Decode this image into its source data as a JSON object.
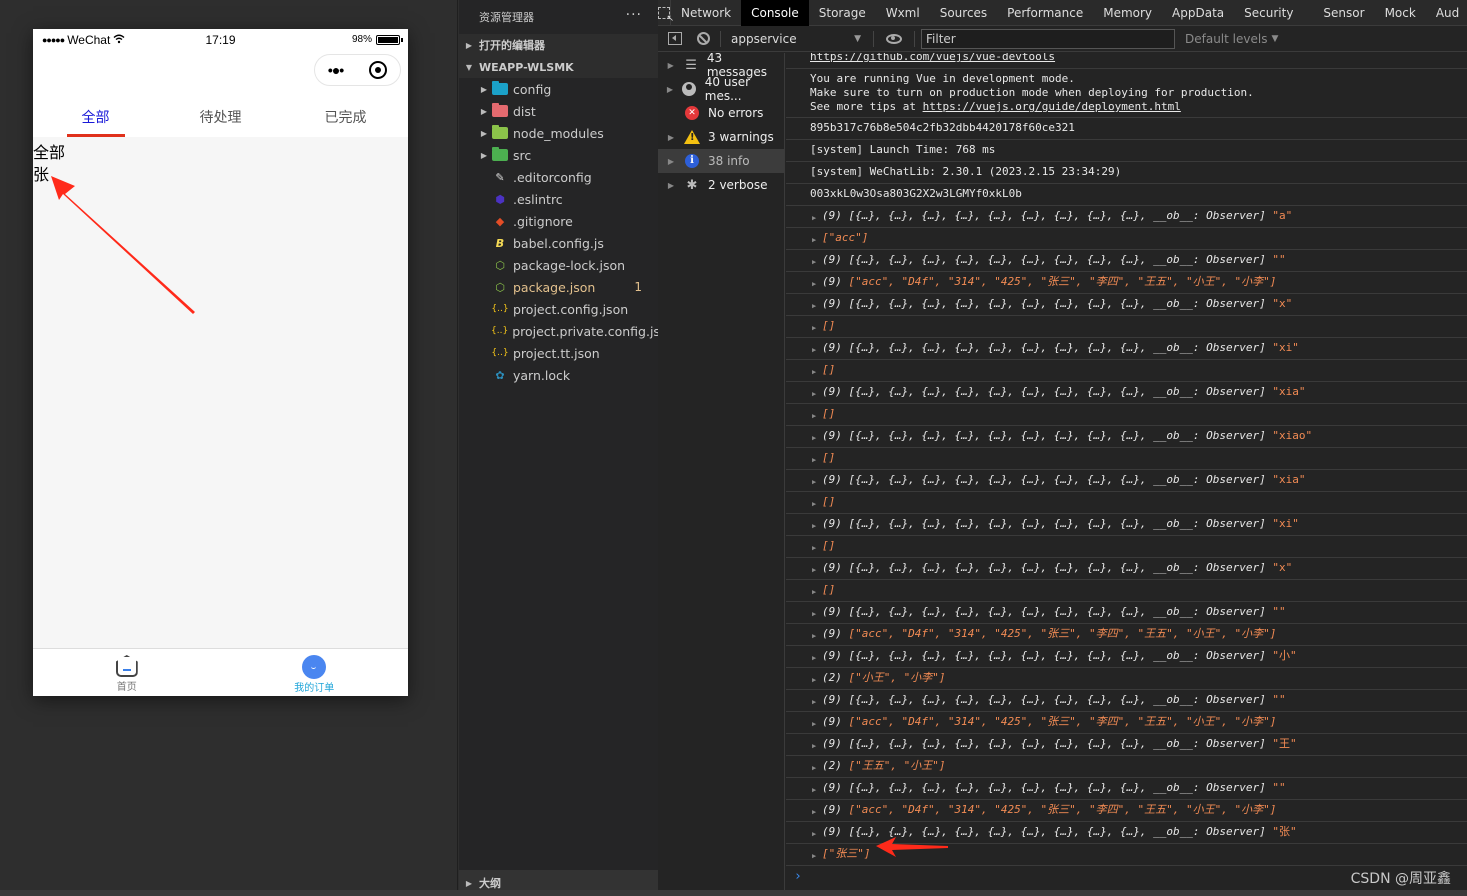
{
  "simulator": {
    "status_bar": {
      "signal": "●●●●●",
      "carrier": "WeChat",
      "wifi_icon": "wifi-icon",
      "time": "17:19",
      "battery_text": "98%",
      "battery_level": 0.98
    },
    "capsule": {
      "more_icon": "•●•",
      "close_icon": "target-icon"
    },
    "tabs": [
      {
        "label": "全部",
        "active": true
      },
      {
        "label": "待处理",
        "active": false
      },
      {
        "label": "已完成",
        "active": false
      }
    ],
    "content_lines": [
      "全部",
      "张"
    ],
    "tabbar": [
      {
        "label": "首页",
        "icon": "home-icon",
        "active": false
      },
      {
        "label": "我的订单",
        "icon": "order-icon",
        "active": true
      }
    ]
  },
  "explorer": {
    "title": "资源管理器",
    "more": "···",
    "open_editors": "打开的编辑器",
    "project_name": "WEAPP-WLSMK",
    "items": [
      {
        "name": "config",
        "type": "folder",
        "color": "#1ba1c8"
      },
      {
        "name": "dist",
        "type": "folder",
        "color": "#e46a6f"
      },
      {
        "name": "node_modules",
        "type": "folder",
        "color": "#8bc34a"
      },
      {
        "name": "src",
        "type": "folder",
        "color": "#4caf50"
      },
      {
        "name": ".editorconfig",
        "type": "file",
        "icon": "editorconfig-icon",
        "glyph": "✎",
        "color": "#ddd"
      },
      {
        "name": ".eslintrc",
        "type": "file",
        "icon": "eslint-icon",
        "glyph": "⬢",
        "color": "#4b32c3"
      },
      {
        "name": ".gitignore",
        "type": "file",
        "icon": "git-icon",
        "glyph": "◆",
        "color": "#e44d26"
      },
      {
        "name": "babel.config.js",
        "type": "file",
        "icon": "babel-icon",
        "glyph": "B",
        "color": "#f5da55"
      },
      {
        "name": "package-lock.json",
        "type": "file",
        "icon": "nodejs-icon",
        "glyph": "⬡",
        "color": "#8bc34a"
      },
      {
        "name": "package.json",
        "type": "file",
        "icon": "nodejs-icon",
        "glyph": "⬡",
        "color": "#8bc34a",
        "modified": true,
        "badge": "1"
      },
      {
        "name": "project.config.json",
        "type": "file",
        "icon": "json-icon",
        "glyph": "{..}",
        "color": "#f5c518"
      },
      {
        "name": "project.private.config.js...",
        "type": "file",
        "icon": "json-icon",
        "glyph": "{..}",
        "color": "#f5c518"
      },
      {
        "name": "project.tt.json",
        "type": "file",
        "icon": "json-icon",
        "glyph": "{..}",
        "color": "#f5c518"
      },
      {
        "name": "yarn.lock",
        "type": "file",
        "icon": "yarn-icon",
        "glyph": "✿",
        "color": "#2c8ebb"
      }
    ],
    "outline": "大纲"
  },
  "devtools": {
    "tabs": [
      "Network",
      "Console",
      "Storage",
      "Wxml",
      "Sources",
      "Performance",
      "Memory",
      "AppData",
      "Security",
      "Sensor",
      "Mock",
      "Aud"
    ],
    "active_tab": "Console",
    "context": "appservice",
    "filter_placeholder": "Filter",
    "levels": "Default levels",
    "sidebar": [
      {
        "label": "43 messages",
        "icon": "list-icon",
        "expandable": true
      },
      {
        "label": "40 user mes...",
        "icon": "user-icon",
        "expandable": true
      },
      {
        "label": "No errors",
        "icon": "error-icon",
        "expandable": false
      },
      {
        "label": "3 warnings",
        "icon": "warning-icon",
        "expandable": true
      },
      {
        "label": "38 info",
        "icon": "info-icon",
        "expandable": true,
        "selected": true
      },
      {
        "label": "2 verbose",
        "icon": "bug-icon",
        "expandable": true
      }
    ],
    "logs": {
      "devtools_link": "https://github.com/vuejs/vue-devtools",
      "vue_mode_line1": "You are running Vue in development mode.",
      "vue_mode_line2": "Make sure to turn on production mode when deploying for production.",
      "vue_mode_line3_prefix": "See more tips at ",
      "vue_mode_link": "https://vuejs.org/guide/deployment.html",
      "hash": "895b317c76b8e504c2fb32dbb4420178f60ce321",
      "launch_time": "[system] Launch Time: 768 ms",
      "wechatlib": "[system] WeChatLib: 2.30.1 (2023.2.15 23:34:29)",
      "code": "003xkL0w3Osa803G2X2w3LGMYf0xkL0b"
    },
    "entries": [
      {
        "kind": "obj",
        "text": "(9) [{…}, {…}, {…}, {…}, {…}, {…}, {…}, {…}, {…}, __ob__: Observer] ",
        "str": "\"a\""
      },
      {
        "kind": "arr",
        "prefix": "",
        "items": "[\"acc\"]"
      },
      {
        "kind": "obj",
        "text": "(9) [{…}, {…}, {…}, {…}, {…}, {…}, {…}, {…}, {…}, __ob__: Observer] ",
        "str": "\"\""
      },
      {
        "kind": "arr",
        "prefix": "(9) ",
        "items": "[\"acc\", \"D4f\", \"314\", \"425\", \"张三\", \"李四\", \"王五\", \"小王\", \"小李\"]"
      },
      {
        "kind": "obj",
        "text": "(9) [{…}, {…}, {…}, {…}, {…}, {…}, {…}, {…}, {…}, __ob__: Observer] ",
        "str": "\"x\""
      },
      {
        "kind": "arr",
        "prefix": "",
        "items": "[]"
      },
      {
        "kind": "obj",
        "text": "(9) [{…}, {…}, {…}, {…}, {…}, {…}, {…}, {…}, {…}, __ob__: Observer] ",
        "str": "\"xi\""
      },
      {
        "kind": "arr",
        "prefix": "",
        "items": "[]"
      },
      {
        "kind": "obj",
        "text": "(9) [{…}, {…}, {…}, {…}, {…}, {…}, {…}, {…}, {…}, __ob__: Observer] ",
        "str": "\"xia\""
      },
      {
        "kind": "arr",
        "prefix": "",
        "items": "[]"
      },
      {
        "kind": "obj",
        "text": "(9) [{…}, {…}, {…}, {…}, {…}, {…}, {…}, {…}, {…}, __ob__: Observer] ",
        "str": "\"xiao\""
      },
      {
        "kind": "arr",
        "prefix": "",
        "items": "[]"
      },
      {
        "kind": "obj",
        "text": "(9) [{…}, {…}, {…}, {…}, {…}, {…}, {…}, {…}, {…}, __ob__: Observer] ",
        "str": "\"xia\""
      },
      {
        "kind": "arr",
        "prefix": "",
        "items": "[]"
      },
      {
        "kind": "obj",
        "text": "(9) [{…}, {…}, {…}, {…}, {…}, {…}, {…}, {…}, {…}, __ob__: Observer] ",
        "str": "\"xi\""
      },
      {
        "kind": "arr",
        "prefix": "",
        "items": "[]"
      },
      {
        "kind": "obj",
        "text": "(9) [{…}, {…}, {…}, {…}, {…}, {…}, {…}, {…}, {…}, __ob__: Observer] ",
        "str": "\"x\""
      },
      {
        "kind": "arr",
        "prefix": "",
        "items": "[]"
      },
      {
        "kind": "obj",
        "text": "(9) [{…}, {…}, {…}, {…}, {…}, {…}, {…}, {…}, {…}, __ob__: Observer] ",
        "str": "\"\""
      },
      {
        "kind": "arr",
        "prefix": "(9) ",
        "items": "[\"acc\", \"D4f\", \"314\", \"425\", \"张三\", \"李四\", \"王五\", \"小王\", \"小李\"]"
      },
      {
        "kind": "obj",
        "text": "(9) [{…}, {…}, {…}, {…}, {…}, {…}, {…}, {…}, {…}, __ob__: Observer] ",
        "str": "\"小\""
      },
      {
        "kind": "arr",
        "prefix": "(2) ",
        "items": "[\"小王\", \"小李\"]"
      },
      {
        "kind": "obj",
        "text": "(9) [{…}, {…}, {…}, {…}, {…}, {…}, {…}, {…}, {…}, __ob__: Observer] ",
        "str": "\"\""
      },
      {
        "kind": "arr",
        "prefix": "(9) ",
        "items": "[\"acc\", \"D4f\", \"314\", \"425\", \"张三\", \"李四\", \"王五\", \"小王\", \"小李\"]"
      },
      {
        "kind": "obj",
        "text": "(9) [{…}, {…}, {…}, {…}, {…}, {…}, {…}, {…}, {…}, __ob__: Observer] ",
        "str": "\"王\""
      },
      {
        "kind": "arr",
        "prefix": "(2) ",
        "items": "[\"王五\", \"小王\"]"
      },
      {
        "kind": "obj",
        "text": "(9) [{…}, {…}, {…}, {…}, {…}, {…}, {…}, {…}, {…}, __ob__: Observer] ",
        "str": "\"\""
      },
      {
        "kind": "arr",
        "prefix": "(9) ",
        "items": "[\"acc\", \"D4f\", \"314\", \"425\", \"张三\", \"李四\", \"王五\", \"小王\", \"小李\"]"
      },
      {
        "kind": "obj",
        "text": "(9) [{…}, {…}, {…}, {…}, {…}, {…}, {…}, {…}, {…}, __ob__: Observer] ",
        "str": "\"张\""
      },
      {
        "kind": "arr",
        "prefix": "",
        "items": "[\"张三\"]"
      }
    ],
    "prompt": "›",
    "watermark": "CSDN @周亚鑫"
  },
  "colors": {
    "accent_red": "#e0311b",
    "tab_active_blue": "#1a1ad8",
    "tabbar_active": "#1fa5d9",
    "console_string": "#f28b54",
    "annotation_arrow": "#ff2a1a"
  }
}
